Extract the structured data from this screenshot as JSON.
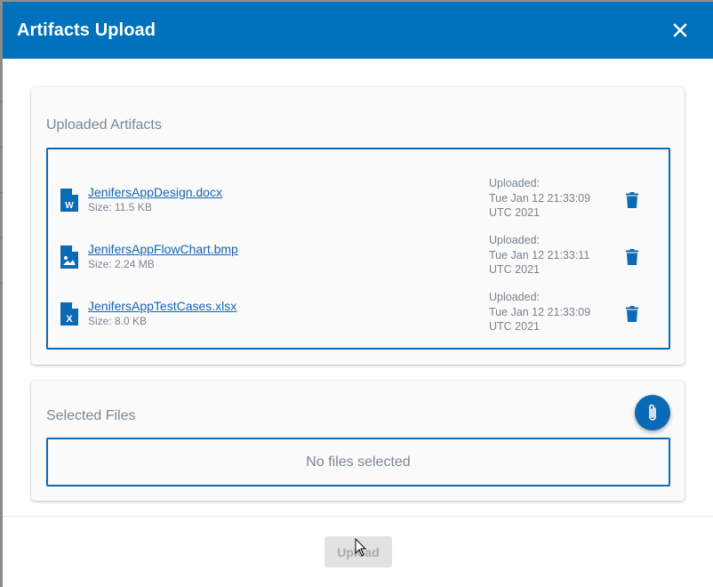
{
  "dialog": {
    "title": "Artifacts Upload",
    "close_icon": "close-icon"
  },
  "uploaded_section": {
    "title": "Uploaded Artifacts",
    "files": [
      {
        "name": "JenifersAppDesign.docx",
        "size": "Size: 11.5 KB",
        "icon": "word-file-icon",
        "uploaded_label": "Uploaded:",
        "uploaded_date": "Tue Jan 12 21:33:09",
        "uploaded_tz_year": "UTC 2021"
      },
      {
        "name": "JenifersAppFlowChart.bmp",
        "size": "Size: 2.24 MB",
        "icon": "image-file-icon",
        "uploaded_label": "Uploaded:",
        "uploaded_date": "Tue Jan 12 21:33:11",
        "uploaded_tz_year": "UTC 2021"
      },
      {
        "name": "JenifersAppTestCases.xlsx",
        "size": "Size: 8.0 KB",
        "icon": "excel-file-icon",
        "uploaded_label": "Uploaded:",
        "uploaded_date": "Tue Jan 12 21:33:09",
        "uploaded_tz_year": "UTC 2021"
      }
    ]
  },
  "selected_section": {
    "title": "Selected Files",
    "empty_text": "No files selected",
    "attach_icon": "paperclip-icon"
  },
  "footer": {
    "upload_label": "Upload"
  },
  "colors": {
    "primary": "#0071bc",
    "accent": "#0a6ab4",
    "muted_text": "#7a8794",
    "disabled_bg": "#e2e2e2"
  }
}
